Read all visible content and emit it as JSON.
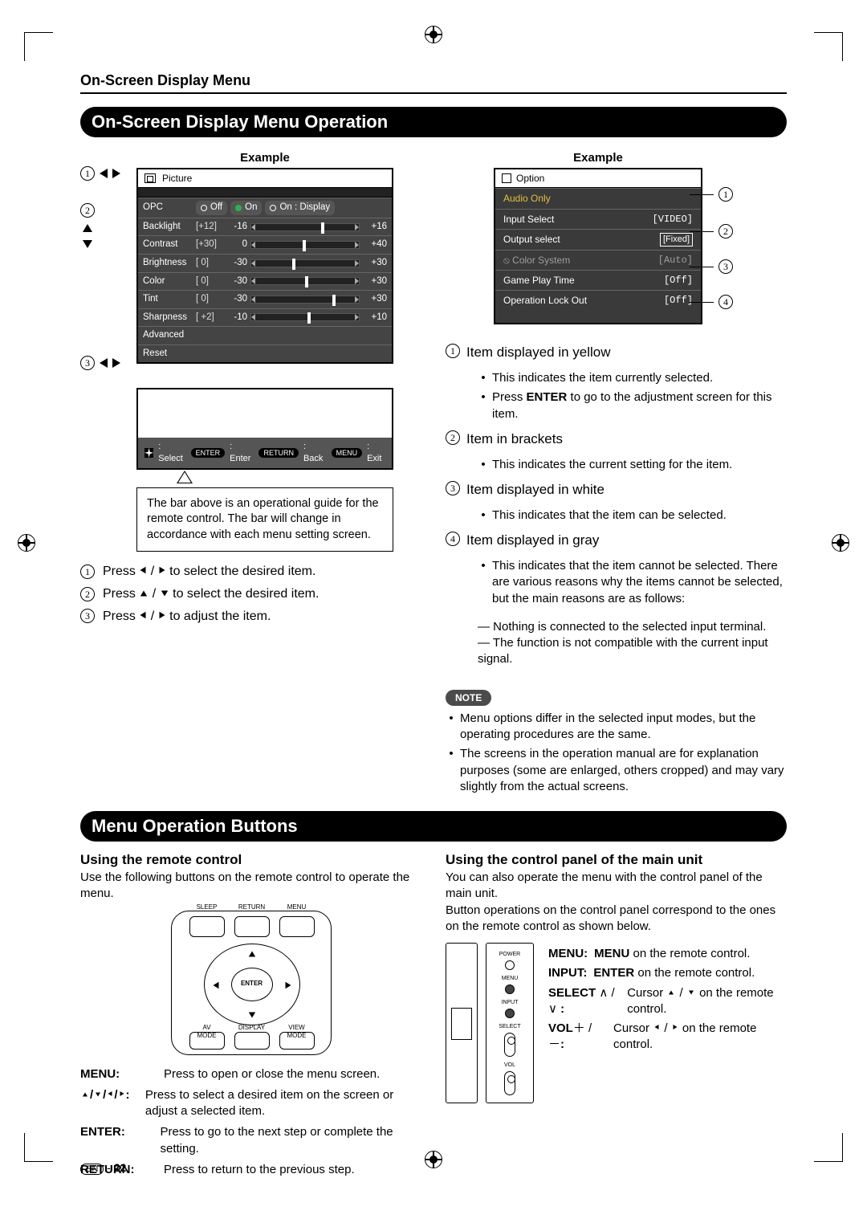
{
  "running_head": "On-Screen Display Menu",
  "section1_title": "On-Screen Display Menu Operation",
  "section2_title": "Menu Operation Buttons",
  "example_label": "Example",
  "left_menu": {
    "title": "Picture",
    "opc_label": "OPC",
    "opc_off": "Off",
    "opc_on": "On",
    "opc_on_display": "On : Display",
    "rows": [
      {
        "name": "Backlight",
        "pre": "[+12]",
        "cur": "-16",
        "max": "+16",
        "thumb": 65
      },
      {
        "name": "Contrast",
        "pre": "[+30]",
        "cur": "0",
        "max": "+40",
        "thumb": 48
      },
      {
        "name": "Brightness",
        "pre": "[   0]",
        "cur": "-30",
        "max": "+30",
        "thumb": 38
      },
      {
        "name": "Color",
        "pre": "[   0]",
        "cur": "-30",
        "max": "+30",
        "thumb": 50
      },
      {
        "name": "Tint",
        "pre": "[   0]",
        "cur": "-30",
        "max": "+30",
        "thumb": 75
      },
      {
        "name": "Sharpness",
        "pre": "[  +2]",
        "cur": "-10",
        "max": "+10",
        "thumb": 52
      }
    ],
    "advanced": "Advanced",
    "reset": "Reset"
  },
  "guide": {
    "select": ": Select",
    "enter": ": Enter",
    "back": ": Back",
    "exit": ": Exit",
    "enter_pill": "ENTER",
    "return_pill": "RETURN",
    "menu_pill": "MENU"
  },
  "callout": "The bar above is an operational guide for the remote control. The bar will change in accordance with each menu setting screen.",
  "steps": {
    "s1_a": "Press ",
    "s1_b": " to select the desired item.",
    "s2_a": "Press ",
    "s2_b": " to select the desired item.",
    "s3_a": "Press ",
    "s3_b": " to adjust the item."
  },
  "right_menu": {
    "title": "Option",
    "r1": {
      "label": "Audio Only"
    },
    "r2": {
      "label": "Input Select",
      "val": "[VIDEO]"
    },
    "r3": {
      "label": "Output select",
      "val": "[Fixed]"
    },
    "r4": {
      "label": "Color System",
      "val": "[Auto]"
    },
    "r5": {
      "label": "Game Play Time",
      "val": "[Off]"
    },
    "r6": {
      "label": "Operation Lock Out",
      "val": "[Off]"
    }
  },
  "desc": {
    "t1": "Item displayed in yellow",
    "b1a": "This indicates the item currently selected.",
    "b1b_a": "Press ",
    "b1b_enter": "ENTER",
    "b1b_b": " to go to the adjustment screen for this item.",
    "t2": "Item in brackets",
    "b2a": "This indicates the current setting for the item.",
    "t3": "Item displayed in white",
    "b3a": "This indicates that the item can be selected.",
    "t4": "Item displayed in gray",
    "b4a": "This indicates that the item cannot be selected. There are various reasons why the items cannot be selected, but the main reasons are as follows:",
    "b4d1": "Nothing is connected to the selected input terminal.",
    "b4d2": "The function is not compatible with the current input signal."
  },
  "note_label": "NOTE",
  "notes": {
    "n1": "Menu options differ in the selected input modes, but the operating procedures are the same.",
    "n2": "The screens in the operation manual are for explanation purposes (some are enlarged, others cropped) and may vary slightly from the actual screens."
  },
  "remote_section": {
    "title": "Using the remote control",
    "intro": "Use the following buttons on the remote control to operate the menu.",
    "labels": {
      "sleep": "SLEEP",
      "return": "RETURN",
      "menu": "MENU",
      "enter": "ENTER",
      "av": "AV\nMODE",
      "display": "DISPLAY",
      "view": "VIEW\nMODE"
    }
  },
  "remote_table": {
    "menu_k": "MENU:",
    "menu_v": "Press to open or close the menu screen.",
    "arrows_v": "Press to select a desired item on the screen or adjust a selected item.",
    "enter_k": "ENTER:",
    "enter_v": "Press to go to the next step or complete the setting.",
    "return_k": "RETURN:",
    "return_v": "Press to return to the previous step."
  },
  "panel_section": {
    "title": "Using the control panel of the main unit",
    "intro1": "You can also operate the menu with the control panel of the main unit.",
    "intro2": "Button operations on the control panel correspond to the ones on the remote control as shown below.",
    "labels": {
      "power": "POWER",
      "menu": "MENU",
      "input": "INPUT",
      "select": "SELECT",
      "vol": "VOL"
    }
  },
  "panel_desc": {
    "menu_k": "MENU:",
    "menu_b": "MENU",
    "menu_v": " on the remote control.",
    "input_k": "INPUT:",
    "input_b": "ENTER",
    "input_v": " on the remote control.",
    "select_k": "SELECT ",
    "select_colon": ":",
    "select_v_a": "Cursor ",
    "select_v_b": " on the remote control.",
    "vol_k": "VOL",
    "vol_colon": ":",
    "vol_v_a": " Cursor ",
    "vol_v_b": " on the remote control."
  },
  "page_num_prefix": " - ",
  "page_num": "22",
  "en": "EN"
}
